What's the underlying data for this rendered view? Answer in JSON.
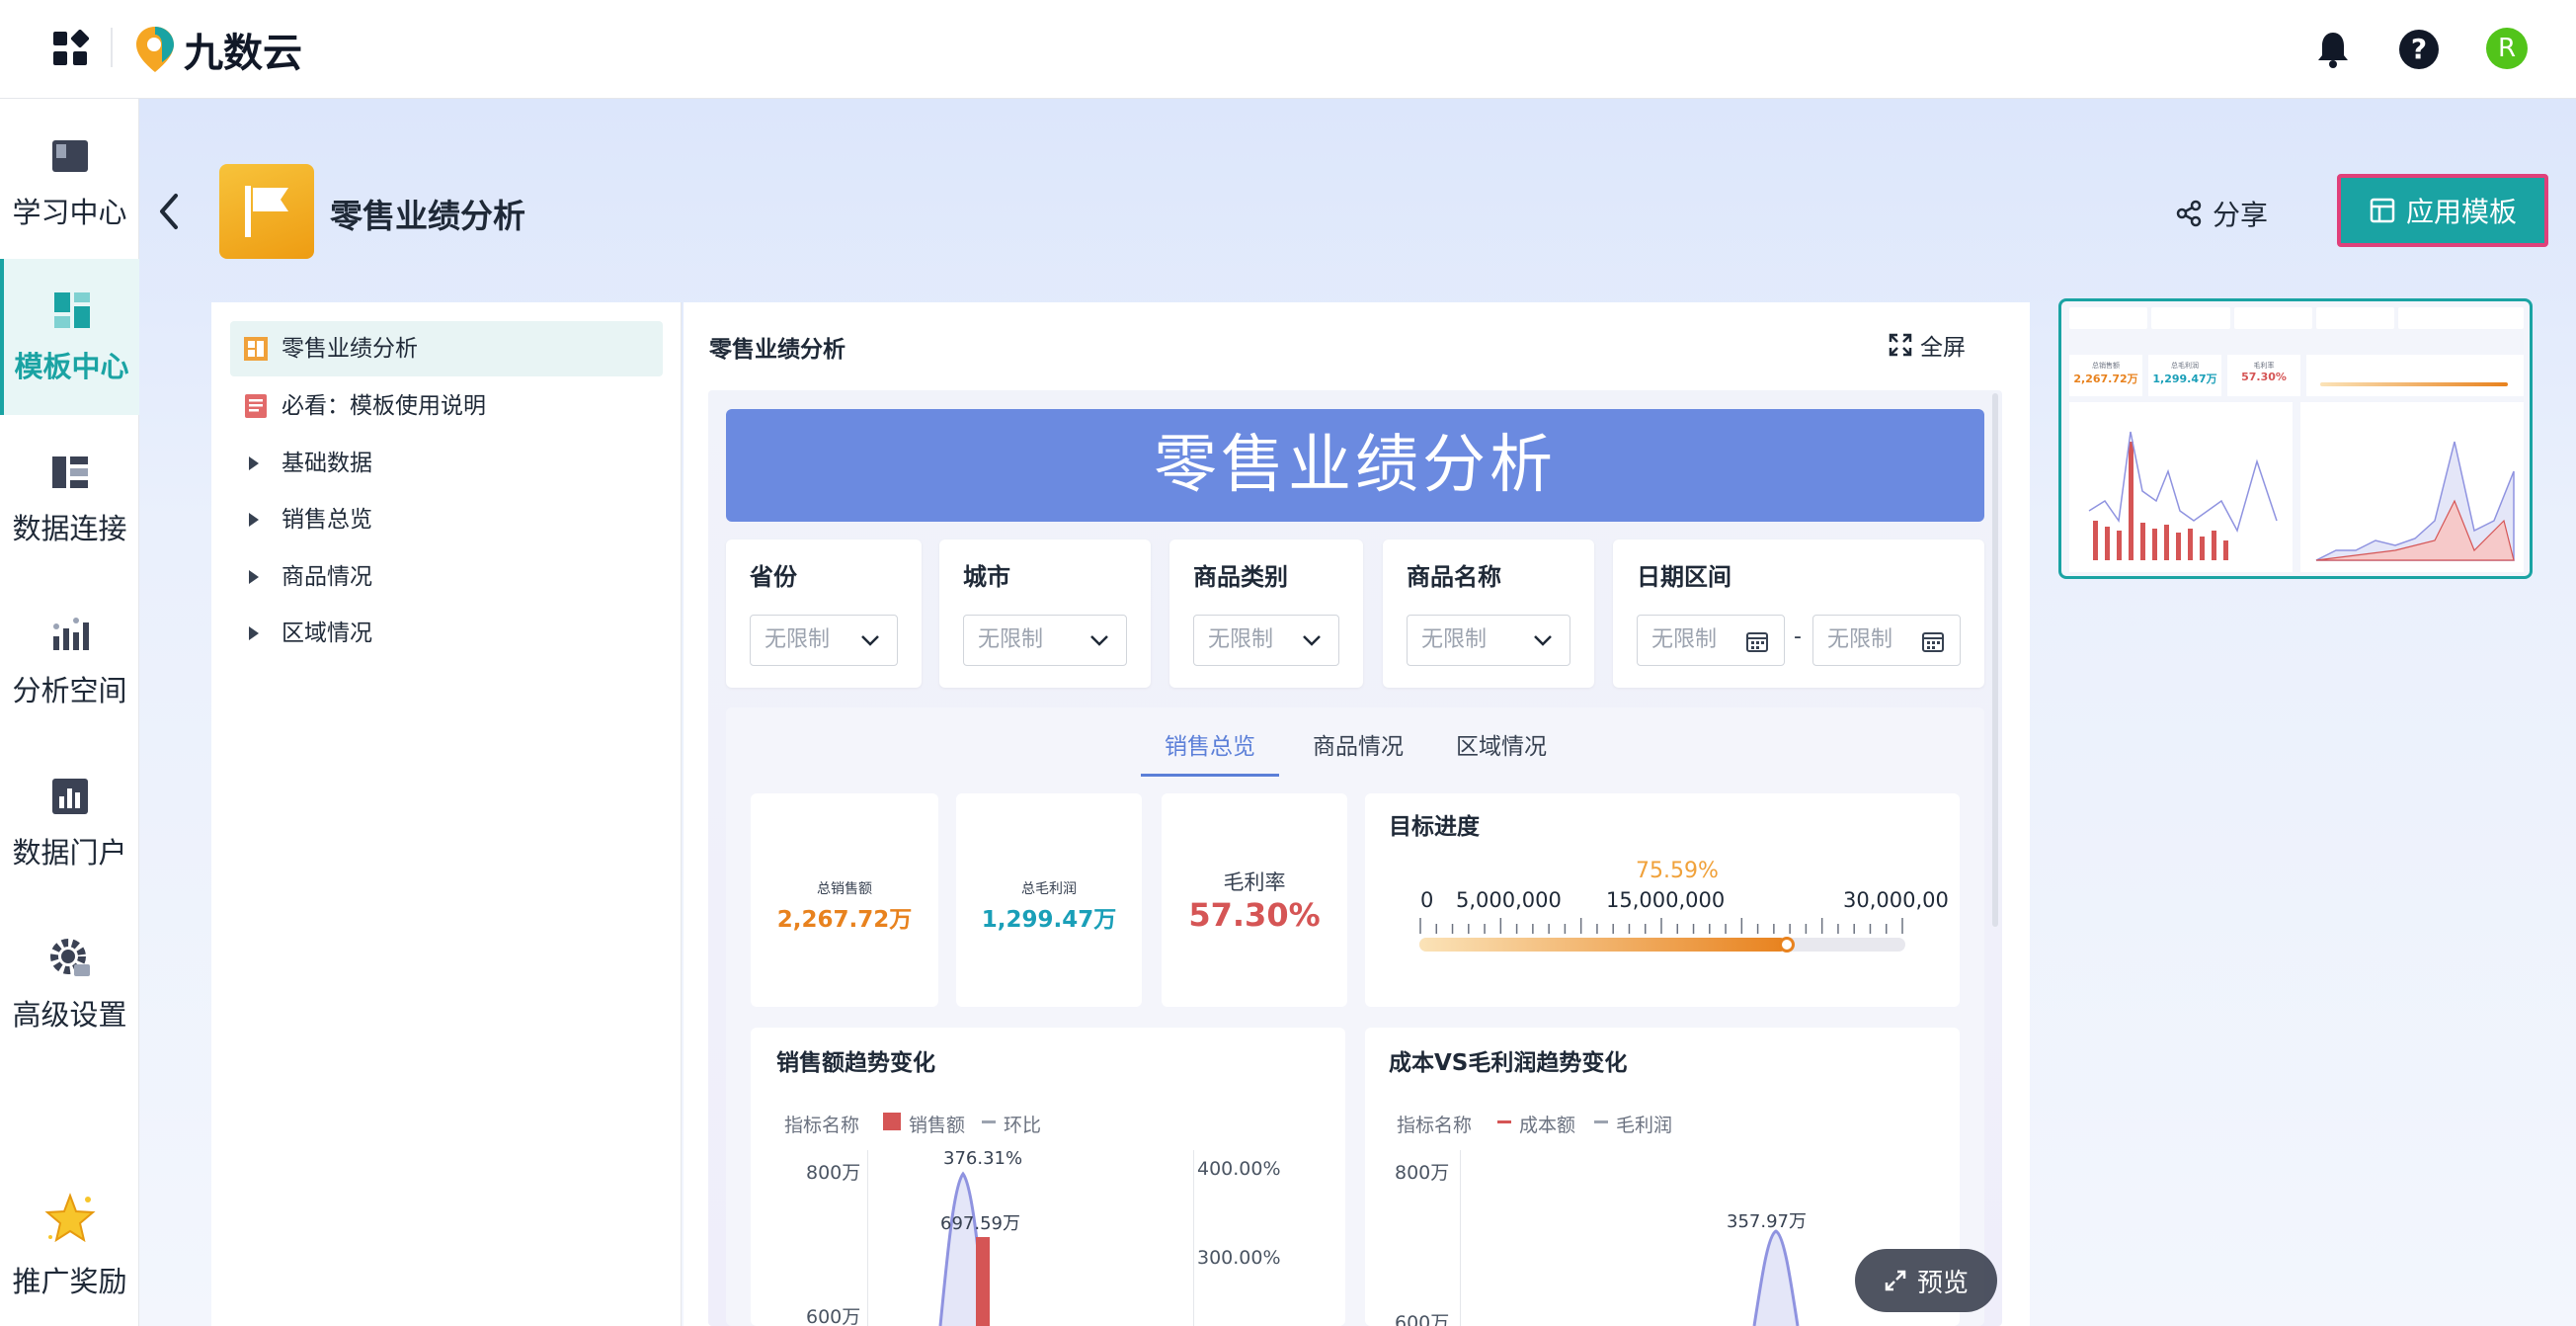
{
  "app": {
    "brand": "九数云"
  },
  "topbar": {
    "user_initial": "R"
  },
  "nav": [
    {
      "label": "学习中心",
      "icon": "book-icon"
    },
    {
      "label": "模板中心",
      "icon": "template-icon"
    },
    {
      "label": "数据连接",
      "icon": "data-link-icon"
    },
    {
      "label": "分析空间",
      "icon": "analysis-icon"
    },
    {
      "label": "数据门户",
      "icon": "portal-icon"
    },
    {
      "label": "高级设置",
      "icon": "gear-icon"
    },
    {
      "label": "推广奖励",
      "icon": "star-icon"
    }
  ],
  "header": {
    "title": "零售业绩分析",
    "share_label": "分享",
    "apply_label": "应用模板"
  },
  "tree": {
    "items": [
      {
        "label": "零售业绩分析"
      },
      {
        "label": "必看：模板使用说明"
      },
      {
        "label": "基础数据"
      },
      {
        "label": "销售总览"
      },
      {
        "label": "商品情况"
      },
      {
        "label": "区域情况"
      }
    ]
  },
  "preview": {
    "title": "零售业绩分析",
    "fullscreen_label": "全屏",
    "banner": "零售业绩分析",
    "filters": [
      {
        "label": "省份",
        "value": "无限制"
      },
      {
        "label": "城市",
        "value": "无限制"
      },
      {
        "label": "商品类别",
        "value": "无限制"
      },
      {
        "label": "商品名称",
        "value": "无限制"
      },
      {
        "label": "日期区间",
        "start": "无限制",
        "end": "无限制",
        "sep": "-"
      }
    ],
    "tabs": [
      "销售总览",
      "商品情况",
      "区域情况"
    ],
    "kpis": [
      {
        "label": "总销售额",
        "value": "2,267.72万"
      },
      {
        "label": "总毛利润",
        "value": "1,299.47万"
      },
      {
        "label": "毛利率",
        "value": "57.30%"
      }
    ],
    "target": {
      "title": "目标进度",
      "percent_label": "75.59%",
      "progress": 0.7559,
      "ticks": [
        "0",
        "5,000,000",
        "15,000,000",
        "30,000,00"
      ]
    },
    "preview_btn": "预览"
  },
  "chart_data": [
    {
      "type": "bar",
      "title": "销售额趋势变化",
      "legend_title": "指标名称",
      "series": [
        {
          "name": "销售额"
        },
        {
          "name": "环比"
        }
      ],
      "y_ticks": [
        "800万",
        "600万"
      ],
      "y2_ticks": [
        "400.00%",
        "300.00%"
      ],
      "annotations": [
        "376.31%",
        "697.59万"
      ]
    },
    {
      "type": "area",
      "title": "成本VS毛利润趋势变化",
      "legend_title": "指标名称",
      "series": [
        {
          "name": "成本额"
        },
        {
          "name": "毛利润"
        }
      ],
      "y_ticks": [
        "800万",
        "600万"
      ],
      "annotations": [
        "357.97万"
      ]
    }
  ],
  "thumb": {
    "kpis": [
      {
        "label": "总销售额",
        "value": "2,267.72万"
      },
      {
        "label": "总毛利润",
        "value": "1,299.47万"
      },
      {
        "label": "毛利率",
        "value": "57.30%"
      }
    ]
  },
  "colors": {
    "accent": "#1aa3a3",
    "banner": "#6b8ae0",
    "orange": "#e8821e",
    "teal": "#1a9fb8",
    "red": "#d55555"
  }
}
